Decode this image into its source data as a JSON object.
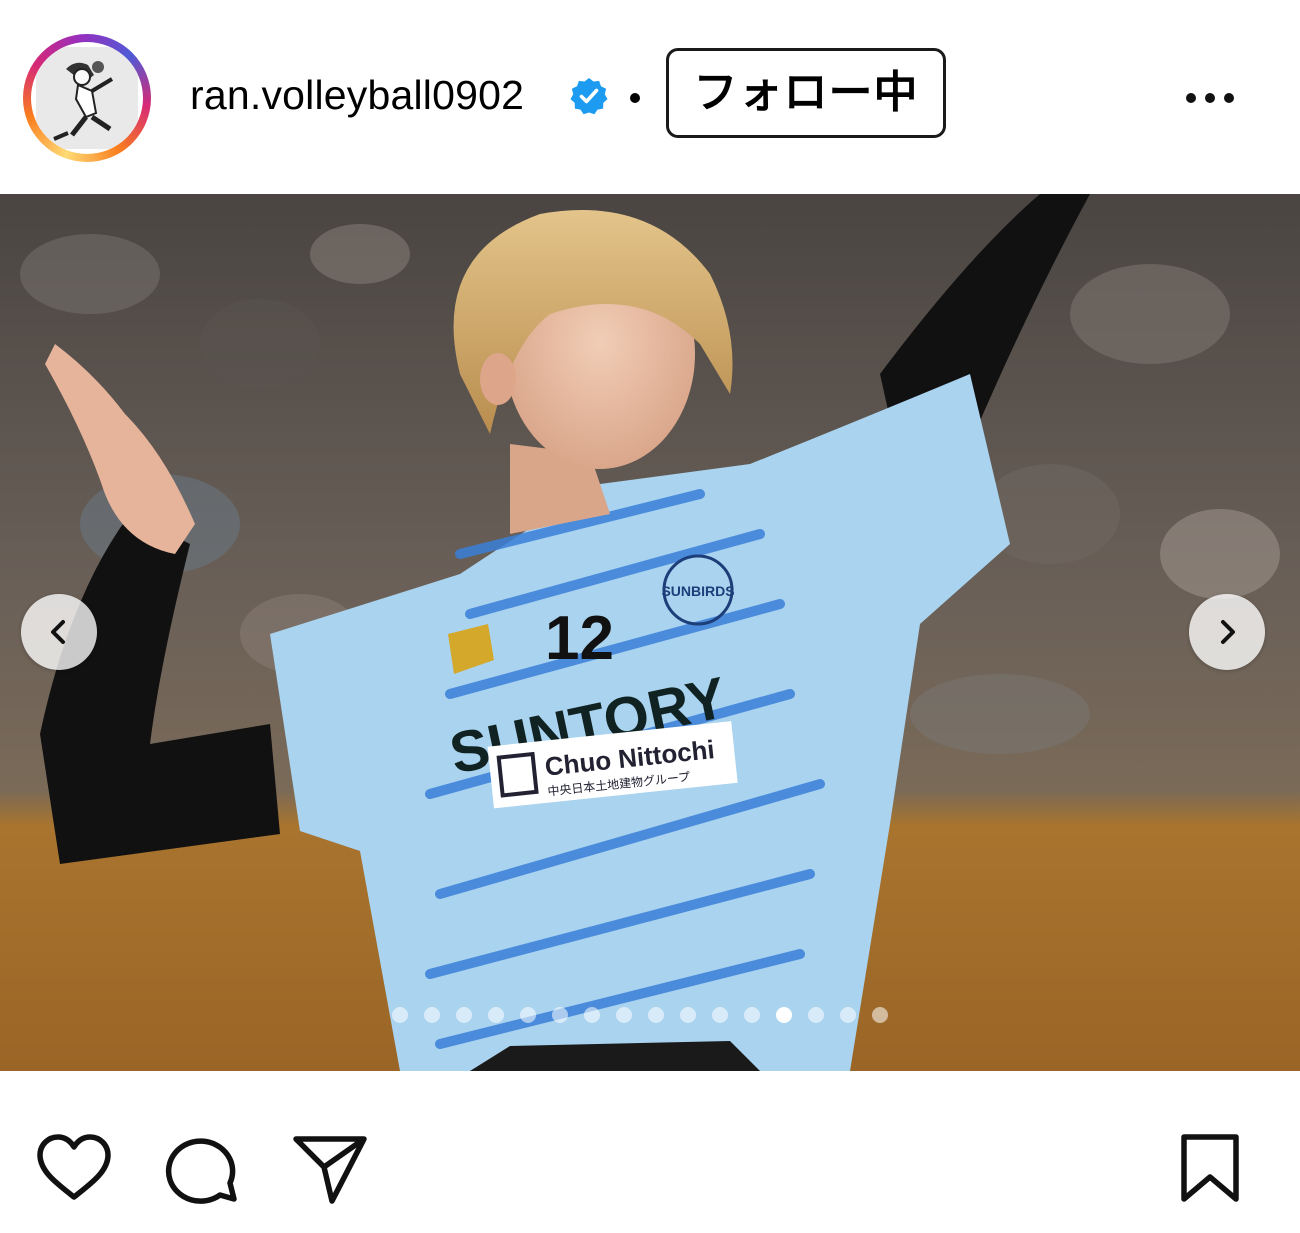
{
  "post_header": {
    "username": "ran.volleyball0902",
    "verified": true,
    "separator": "•",
    "follow_button_label": "フォロー中",
    "more_icon": "more-horizontal-icon",
    "avatar_icon": "avatar-illustration"
  },
  "media": {
    "prev_icon": "chevron-left-icon",
    "next_icon": "chevron-right-icon",
    "jersey_number": "12",
    "jersey_brand": "SUNTORY",
    "sponsor_text": "Chuo Nittochi",
    "sponsor_subtext": "中央日本土地建物グループ",
    "team_badge": "SUNBIRDS",
    "carousel": {
      "total": 16,
      "active_index": 12
    }
  },
  "actions": {
    "like_icon": "heart-icon",
    "comment_icon": "comment-icon",
    "share_icon": "send-icon",
    "save_icon": "bookmark-icon"
  },
  "colors": {
    "verified_blue": "#1d9bf0",
    "jersey_light_blue": "#a9d3ef",
    "jersey_stripe_blue": "#3a7fd8"
  }
}
